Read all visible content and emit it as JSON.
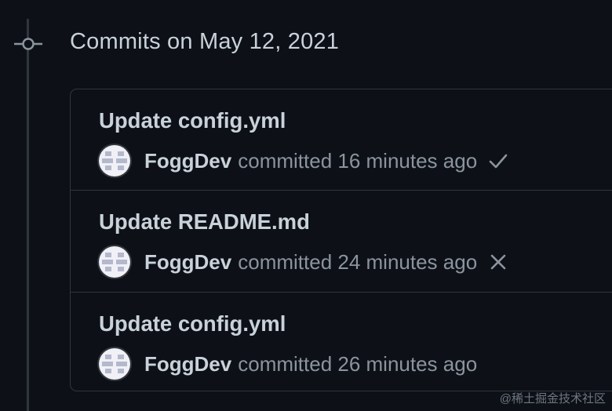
{
  "group": {
    "heading": "Commits on May 12, 2021"
  },
  "commits": [
    {
      "title": "Update config.yml",
      "author": "FoggDev",
      "committed": "committed 16 minutes ago",
      "status": "success",
      "status_icon": "check-icon"
    },
    {
      "title": "Update README.md",
      "author": "FoggDev",
      "committed": "committed 24 minutes ago",
      "status": "failure",
      "status_icon": "x-icon"
    },
    {
      "title": "Update config.yml",
      "author": "FoggDev",
      "committed": "committed 26 minutes ago",
      "status": "none",
      "status_icon": ""
    }
  ],
  "watermark": "@稀土掘金技术社区",
  "colors": {
    "background": "#0d1117",
    "border": "#30363d",
    "text_primary": "#c9d1d9",
    "text_muted": "#8b949e"
  }
}
